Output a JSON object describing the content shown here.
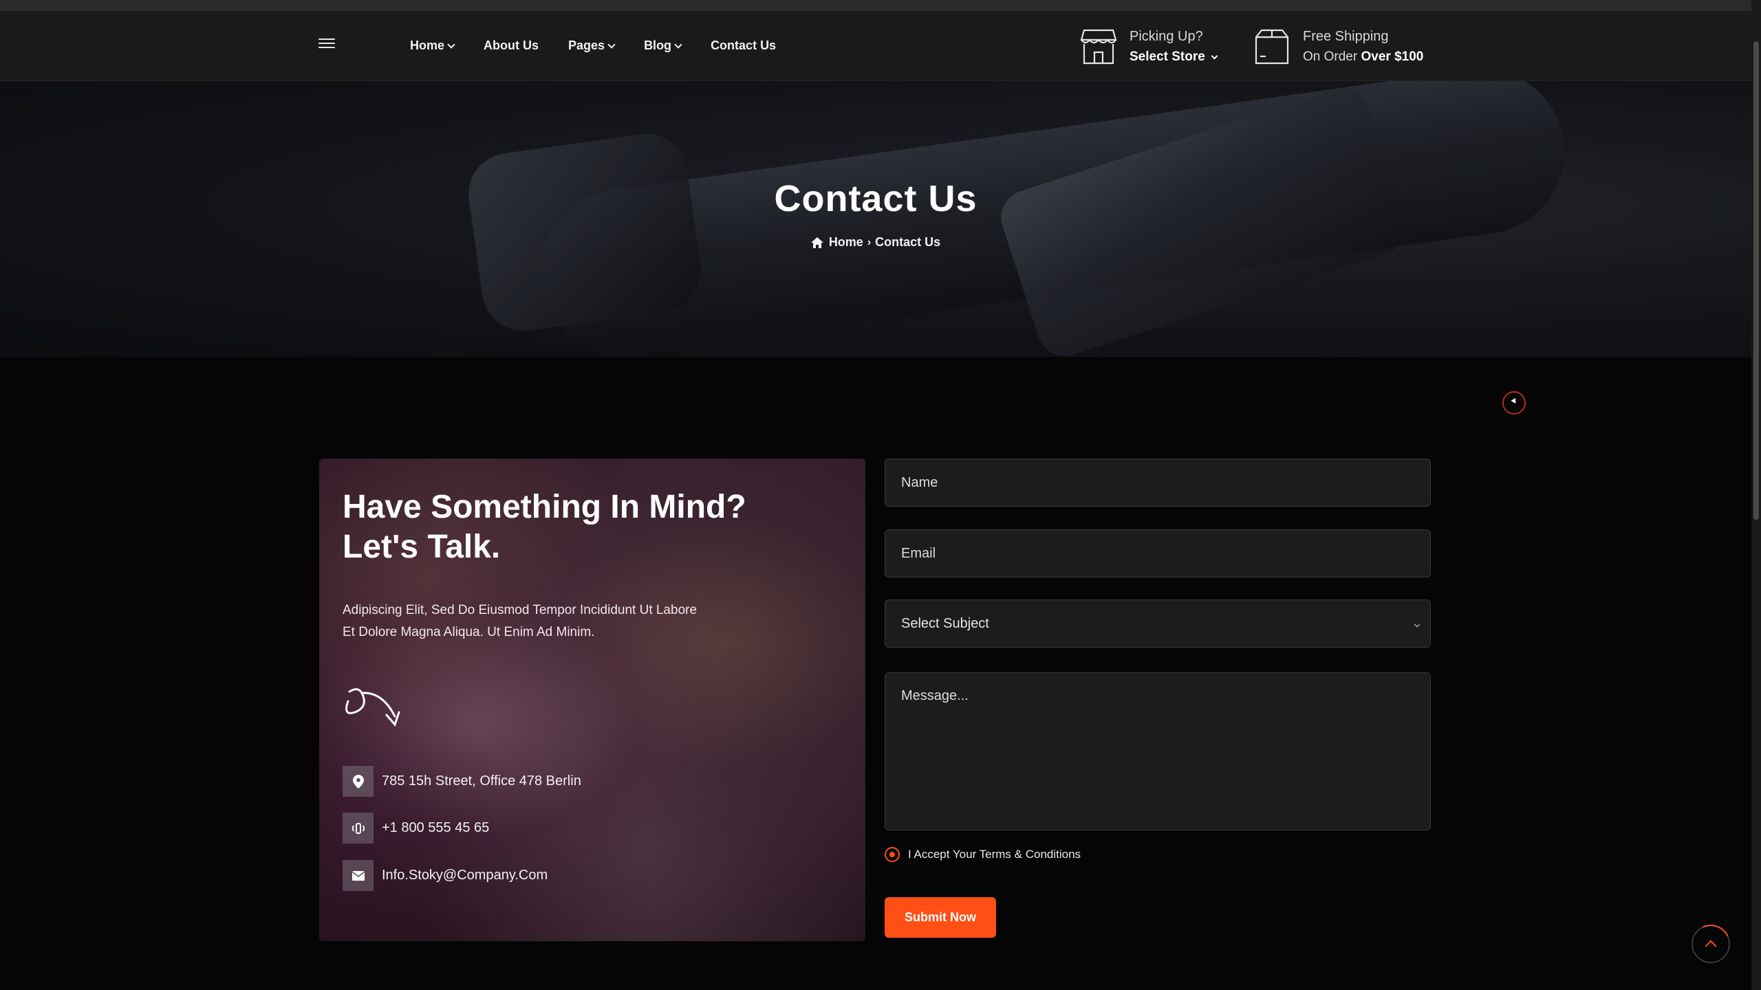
{
  "header": {
    "nav": [
      {
        "label": "Home",
        "dropdown": true
      },
      {
        "label": "About Us",
        "dropdown": false
      },
      {
        "label": "Pages",
        "dropdown": true
      },
      {
        "label": "Blog",
        "dropdown": true
      },
      {
        "label": "Contact Us",
        "dropdown": false
      }
    ],
    "pickup": {
      "line1": "Picking Up?",
      "line2": "Select Store"
    },
    "shipping": {
      "line1": "Free Shipping",
      "line2_prefix": "On Order",
      "line2_bold": "Over $100"
    }
  },
  "hero": {
    "title": "Contact Us",
    "breadcrumb": {
      "home": "Home",
      "current": "Contact Us"
    }
  },
  "contact_card": {
    "title_line1": "Have Something In Mind?",
    "title_line2": "Let's Talk.",
    "text_line1": "Adipiscing Elit, Sed Do Eiusmod Tempor Incididunt Ut Labore",
    "text_line2": "Et Dolore Magna Aliqua. Ut Enim Ad Minim.",
    "address": "785 15h Street, Office 478 Berlin",
    "phone": "+1 800 555 45 65",
    "email": "Info.Stoky@Company.Com"
  },
  "form": {
    "name_placeholder": "Name",
    "email_placeholder": "Email",
    "subject_selected": "Select Subject",
    "message_placeholder": "Message...",
    "terms_label": "I Accept Your Terms & Conditions",
    "submit_label": "Submit Now"
  },
  "colors": {
    "accent": "#ff4f14",
    "background": "#050505",
    "header": "#1a1a1a",
    "field": "#1c1c1c"
  },
  "icons": [
    "hamburger-icon",
    "store-icon",
    "box-icon",
    "home-icon",
    "location-pin-icon",
    "phone-icon",
    "envelope-icon",
    "curved-arrow-icon",
    "chevron-up-icon"
  ]
}
